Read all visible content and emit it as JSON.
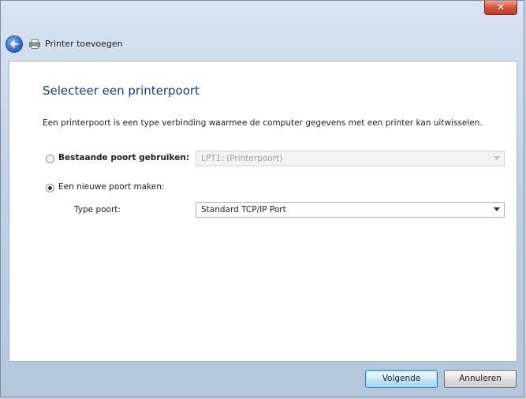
{
  "window": {
    "close_label": "✕",
    "wizard_title": "Printer toevoegen"
  },
  "page": {
    "title": "Selecteer een printerpoort",
    "description": "Een printerpoort is een type verbinding waarmee de computer gegevens met een printer kan uitwisselen."
  },
  "options": {
    "existing_port": {
      "label": "Bestaande poort gebruiken:",
      "selected": false,
      "select_value": "LPT1: (Printerpoort)",
      "disabled": true
    },
    "new_port": {
      "label": "Een nieuwe poort maken:",
      "selected": true,
      "type_label": "Type poort:",
      "select_value": "Standard TCP/IP Port"
    }
  },
  "footer": {
    "next_label": "Volgende",
    "cancel_label": "Annuleren"
  },
  "icons": {
    "back": "back-arrow-icon",
    "wizard": "printer-icon",
    "close": "close-icon"
  },
  "colors": {
    "title_blue": "#1a3a8a",
    "close_red": "#d5533b"
  }
}
